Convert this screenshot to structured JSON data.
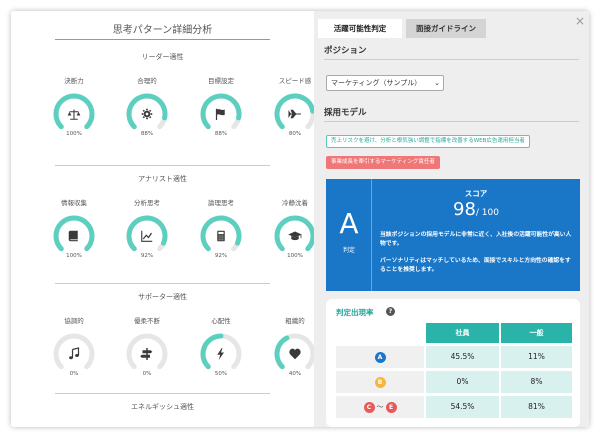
{
  "left": {
    "title": "思考パターン詳細分析",
    "sections": [
      {
        "title": "リーダー適性",
        "gauges": [
          {
            "label": "決断力",
            "value": 100,
            "pct_text": "100%",
            "icon": "scales-icon"
          },
          {
            "label": "合理的",
            "value": 88,
            "pct_text": "88%",
            "icon": "gear-icon"
          },
          {
            "label": "目標設定",
            "value": 88,
            "pct_text": "88%",
            "icon": "flag-icon"
          },
          {
            "label": "スピード感",
            "value": 80,
            "pct_text": "80%",
            "icon": "airplane-icon"
          }
        ]
      },
      {
        "title": "アナリスト適性",
        "gauges": [
          {
            "label": "情報収集",
            "value": 100,
            "pct_text": "100%",
            "icon": "book-icon"
          },
          {
            "label": "分析思考",
            "value": 92,
            "pct_text": "92%",
            "icon": "trend-chart-icon"
          },
          {
            "label": "論理思考",
            "value": 92,
            "pct_text": "92%",
            "icon": "calculator-icon"
          },
          {
            "label": "冷静沈着",
            "value": 100,
            "pct_text": "100%",
            "icon": "graduation-cap-icon"
          }
        ]
      },
      {
        "title": "サポーター適性",
        "gauges": [
          {
            "label": "協調的",
            "value": 0,
            "pct_text": "0%",
            "icon": "music-note-icon"
          },
          {
            "label": "優柔不断",
            "value": 0,
            "pct_text": "0%",
            "icon": "signpost-icon"
          },
          {
            "label": "心配性",
            "value": 50,
            "pct_text": "50%",
            "icon": "lightning-icon"
          },
          {
            "label": "粗織的",
            "value": 40,
            "pct_text": "40%",
            "icon": "heart-icon"
          }
        ]
      },
      {
        "title": "エネルギッシュ適性",
        "gauges": []
      }
    ]
  },
  "right": {
    "tabs": [
      {
        "label": "活躍可能性判定",
        "active": true
      },
      {
        "label": "面接ガイドライン",
        "active": false
      }
    ],
    "close_label": "×",
    "position_label": "ポジション",
    "position_value": "マーケティング（サンプル）",
    "model_label": "採用モデル",
    "tags": [
      {
        "text": "売上リスクを避け、分析と根気強い調整で指標を改善するWEB広告運用担当者",
        "style": "teal"
      },
      {
        "text": "事業成長を牽引するマーケティング責任者",
        "style": "red"
      }
    ],
    "score": {
      "grade": "A",
      "grade_caption": "判定",
      "title": "スコア",
      "value": "98",
      "max": "/ 100",
      "desc1": "当該ポジションの採用モデルに非常に近く、入社後の活躍可能性が高い人物です。",
      "desc2": "パーソナリティはマッチしているため、面接でスキルと方向性の確認をすることを推奨します。"
    },
    "rate": {
      "title": "判定出現率",
      "help": "?",
      "headers": [
        "社員",
        "一般"
      ],
      "rows": [
        {
          "badges": [
            "A"
          ],
          "employee": "45.5%",
          "general": "11%"
        },
        {
          "badges": [
            "B"
          ],
          "employee": "0%",
          "general": "8%"
        },
        {
          "badges": [
            "C",
            "E"
          ],
          "tilde": "〜",
          "employee": "54.5%",
          "general": "81%"
        }
      ]
    }
  },
  "colors": {
    "gauge_fill": "#5ccfc0",
    "gauge_track": "#e6e6e6",
    "gauge_icon": "#3a3a3a",
    "score_bg": "#1a76c6",
    "teal": "#2ab3a8"
  }
}
